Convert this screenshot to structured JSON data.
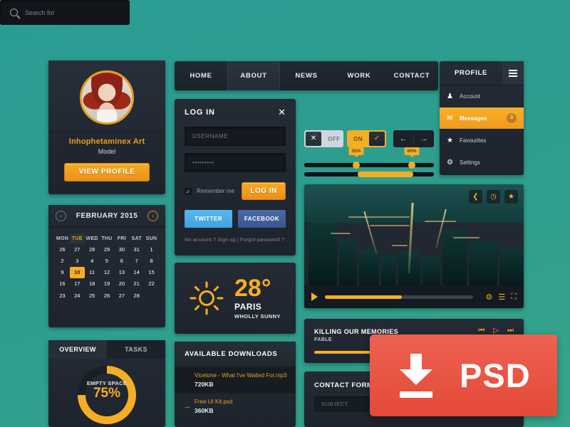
{
  "theme": {
    "background_teal": "#2a9d93",
    "accent_orange": "#f5ae24",
    "panel_dark": "#242b35",
    "psd_red": "#e34a38"
  },
  "profile_card": {
    "name": "Inhophetaminex Art",
    "role": "Model",
    "button_label": "VIEW PROFILE"
  },
  "calendar": {
    "title": "FEBRUARY 2015",
    "prev_icon": "chevron-left",
    "next_icon": "chevron-right",
    "day_names": [
      "MON",
      "TUE",
      "WED",
      "THU",
      "FRI",
      "SAT",
      "SUN"
    ],
    "selected_day_name": "TUE",
    "selected_date": "10",
    "weeks": [
      [
        "26",
        "27",
        "28",
        "29",
        "30",
        "31",
        "1"
      ],
      [
        "2",
        "3",
        "4",
        "5",
        "6",
        "7",
        "8"
      ],
      [
        "9",
        "10",
        "11",
        "12",
        "13",
        "14",
        "15"
      ],
      [
        "16",
        "17",
        "18",
        "19",
        "20",
        "21",
        "22"
      ],
      [
        "23",
        "24",
        "25",
        "26",
        "27",
        "28",
        ""
      ]
    ]
  },
  "overview": {
    "tabs": [
      {
        "label": "OVERVIEW",
        "active": true
      },
      {
        "label": "TASKS",
        "active": false
      }
    ],
    "donut_label": "EMPTY SPACE",
    "donut_value": "75%"
  },
  "top_nav": {
    "items": [
      {
        "label": "HOME",
        "active": false
      },
      {
        "label": "ABOUT",
        "active": true
      },
      {
        "label": "NEWS",
        "active": false
      },
      {
        "label": "WORK",
        "active": false
      },
      {
        "label": "CONTACT",
        "active": false
      }
    ]
  },
  "login": {
    "title": "LOG IN",
    "close_icon": "close-icon",
    "username_placeholder": "USERNAME",
    "password_value": "•••••••••",
    "remember_label": "Remember me",
    "remember_checked": true,
    "submit_label": "LOG IN",
    "twitter_label": "TWITTER",
    "facebook_label": "FACEBOOK",
    "signup_text": "No account ? Sign up",
    "separator": "|",
    "forgot_text": "Forgot password ?"
  },
  "weather": {
    "icon": "sun-icon",
    "temperature": "28°",
    "city": "PARIS",
    "condition": "WHOLLY SUNNY"
  },
  "downloads": {
    "title": "AVAILABLE DOWNLOADS",
    "items": [
      {
        "name": "Vicetone - What I've Waited For.mp3",
        "size": "720KB",
        "arrow": ""
      },
      {
        "name": "Free UI Kit.psd",
        "size": "360KB",
        "arrow": "→"
      }
    ]
  },
  "search": {
    "icon": "search-icon",
    "placeholder": "Search for"
  },
  "toggles": {
    "off": {
      "label": "OFF",
      "icon": "✕"
    },
    "on": {
      "label": "ON",
      "icon": "✓"
    },
    "prev_icon": "←",
    "next_icon": "→"
  },
  "sliders": {
    "slider_a": {
      "value_a": "35%",
      "value_b": "80%"
    },
    "slider_b": {
      "range_label": ""
    }
  },
  "video": {
    "share_icon": "share-icon",
    "clock_icon": "clock-icon",
    "star_icon": "star-icon",
    "play_icon": "play-icon",
    "settings_icon": "gear-icon",
    "equalizer_icon": "equalizer-icon",
    "fullscreen_icon": "fullscreen-icon"
  },
  "music": {
    "title": "KILLING OUR MEMORIES",
    "artist": "FABLE",
    "prev_icon": "⏮",
    "play_icon": "▷",
    "next_icon": "⏭"
  },
  "contact": {
    "title": "CONTACT FORM",
    "subject_placeholder": "SUBJECT"
  },
  "sidebar": {
    "title": "PROFILE",
    "menu_icon": "hamburger-icon",
    "items": [
      {
        "label": "Account",
        "icon": "user-icon",
        "active": false,
        "badge": ""
      },
      {
        "label": "Messages",
        "icon": "message-icon",
        "active": true,
        "badge": "3"
      },
      {
        "label": "Favourites",
        "icon": "star-icon",
        "active": false,
        "badge": ""
      },
      {
        "label": "Settings",
        "icon": "gear-icon",
        "active": false,
        "badge": ""
      }
    ]
  },
  "psd_badge": {
    "label": "PSD",
    "icon": "download-icon"
  }
}
